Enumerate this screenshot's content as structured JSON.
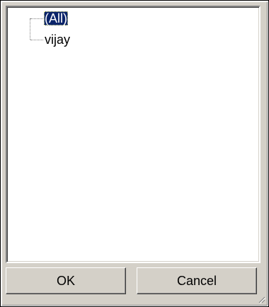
{
  "tree": {
    "items": [
      {
        "label": "(All)",
        "selected": true
      },
      {
        "label": "vijay",
        "selected": false
      }
    ]
  },
  "buttons": {
    "ok_label": "OK",
    "cancel_label": "Cancel"
  },
  "colors": {
    "selection": "#0a246a",
    "dialog_face": "#d4d0c8"
  }
}
